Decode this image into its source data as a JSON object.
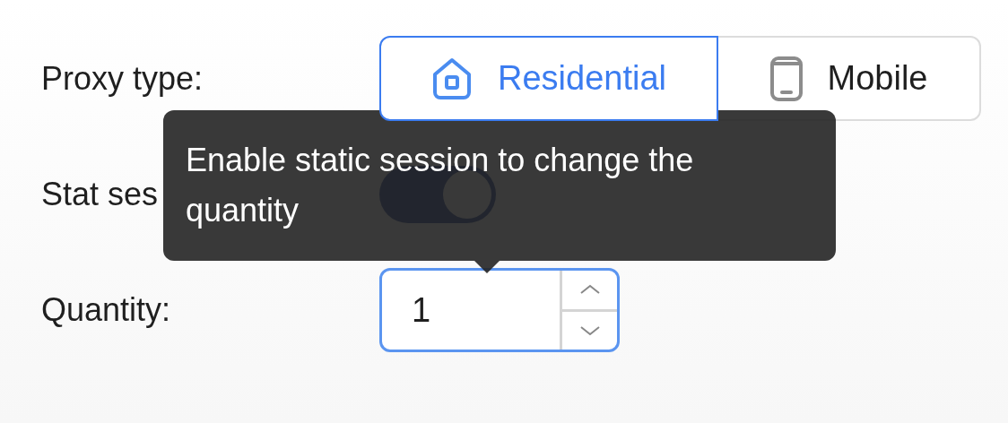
{
  "fields": [
    {
      "kind": "segmented",
      "label": "Proxy type:",
      "options": [
        {
          "label": "Residential",
          "selected": true
        },
        {
          "label": "Mobile",
          "selected": false
        }
      ]
    },
    {
      "kind": "toggle",
      "label": "Stat ses",
      "on": true
    },
    {
      "kind": "number",
      "label": "Quantity:",
      "value": "1"
    }
  ],
  "tooltip": {
    "text": "Enable static session to change the quantity"
  }
}
